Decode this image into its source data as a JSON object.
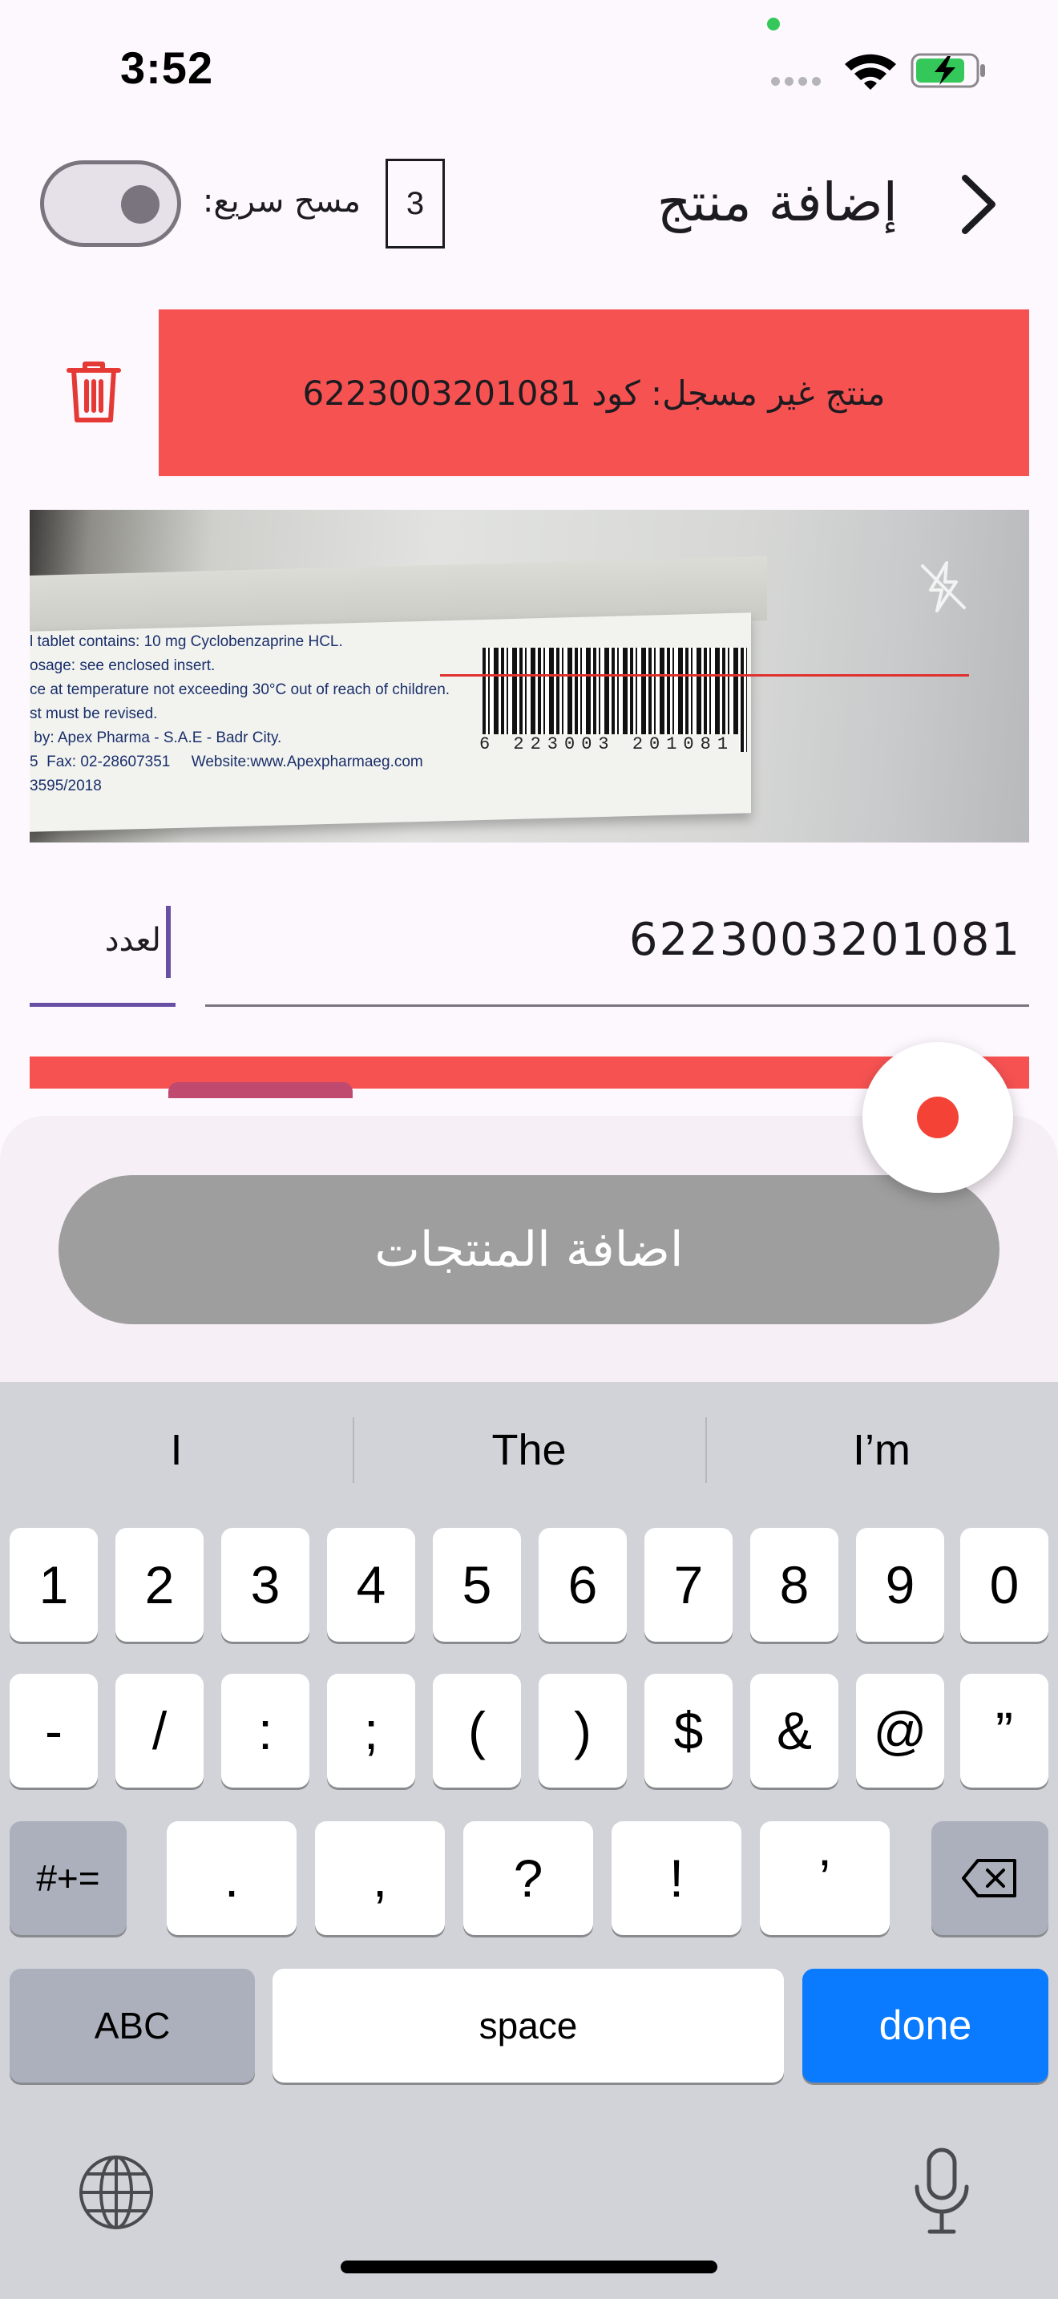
{
  "status_bar": {
    "time": "3:52"
  },
  "header": {
    "title": "إضافة منتج",
    "count": "3",
    "quick_scan_label": "مسح سريع:"
  },
  "error_banner": {
    "message": "منتج غير مسجل: كود 6223003201081"
  },
  "camera": {
    "box_text": "l tablet contains: 10 mg Cyclobenzaprine HCL.\nosage: see enclosed insert.\nce at temperature not exceeding 30°C out of reach of children.\nst must be revised.\n by: Apex Pharma - S.A.E - Badr City.\n5  Fax: 02-28607351     Website:www.Apexpharmaeg.com\n3595/2018",
    "barcode_digits": "6 223003 201081"
  },
  "form": {
    "barcode_value": "6223003201081",
    "quantity_label": "لعدد"
  },
  "actions": {
    "add_products_label": "اضافة المنتجات"
  },
  "keyboard": {
    "suggestions": [
      "I",
      "The",
      "I’m"
    ],
    "row1": [
      "1",
      "2",
      "3",
      "4",
      "5",
      "6",
      "7",
      "8",
      "9",
      "0"
    ],
    "row2": [
      "-",
      "/",
      ":",
      ";",
      "(",
      ")",
      "$",
      "&",
      "@",
      "”"
    ],
    "row3": {
      "symbols": "#+=",
      "keys": [
        ".",
        ",",
        "?",
        "!",
        "’"
      ]
    },
    "row4": {
      "abc": "ABC",
      "space": "space",
      "done": "done"
    }
  },
  "colors": {
    "error": "#f75252",
    "accent": "#6750a4",
    "done_key": "#0a7aff",
    "record": "#f44336",
    "button_disabled": "#9e9e9e"
  }
}
